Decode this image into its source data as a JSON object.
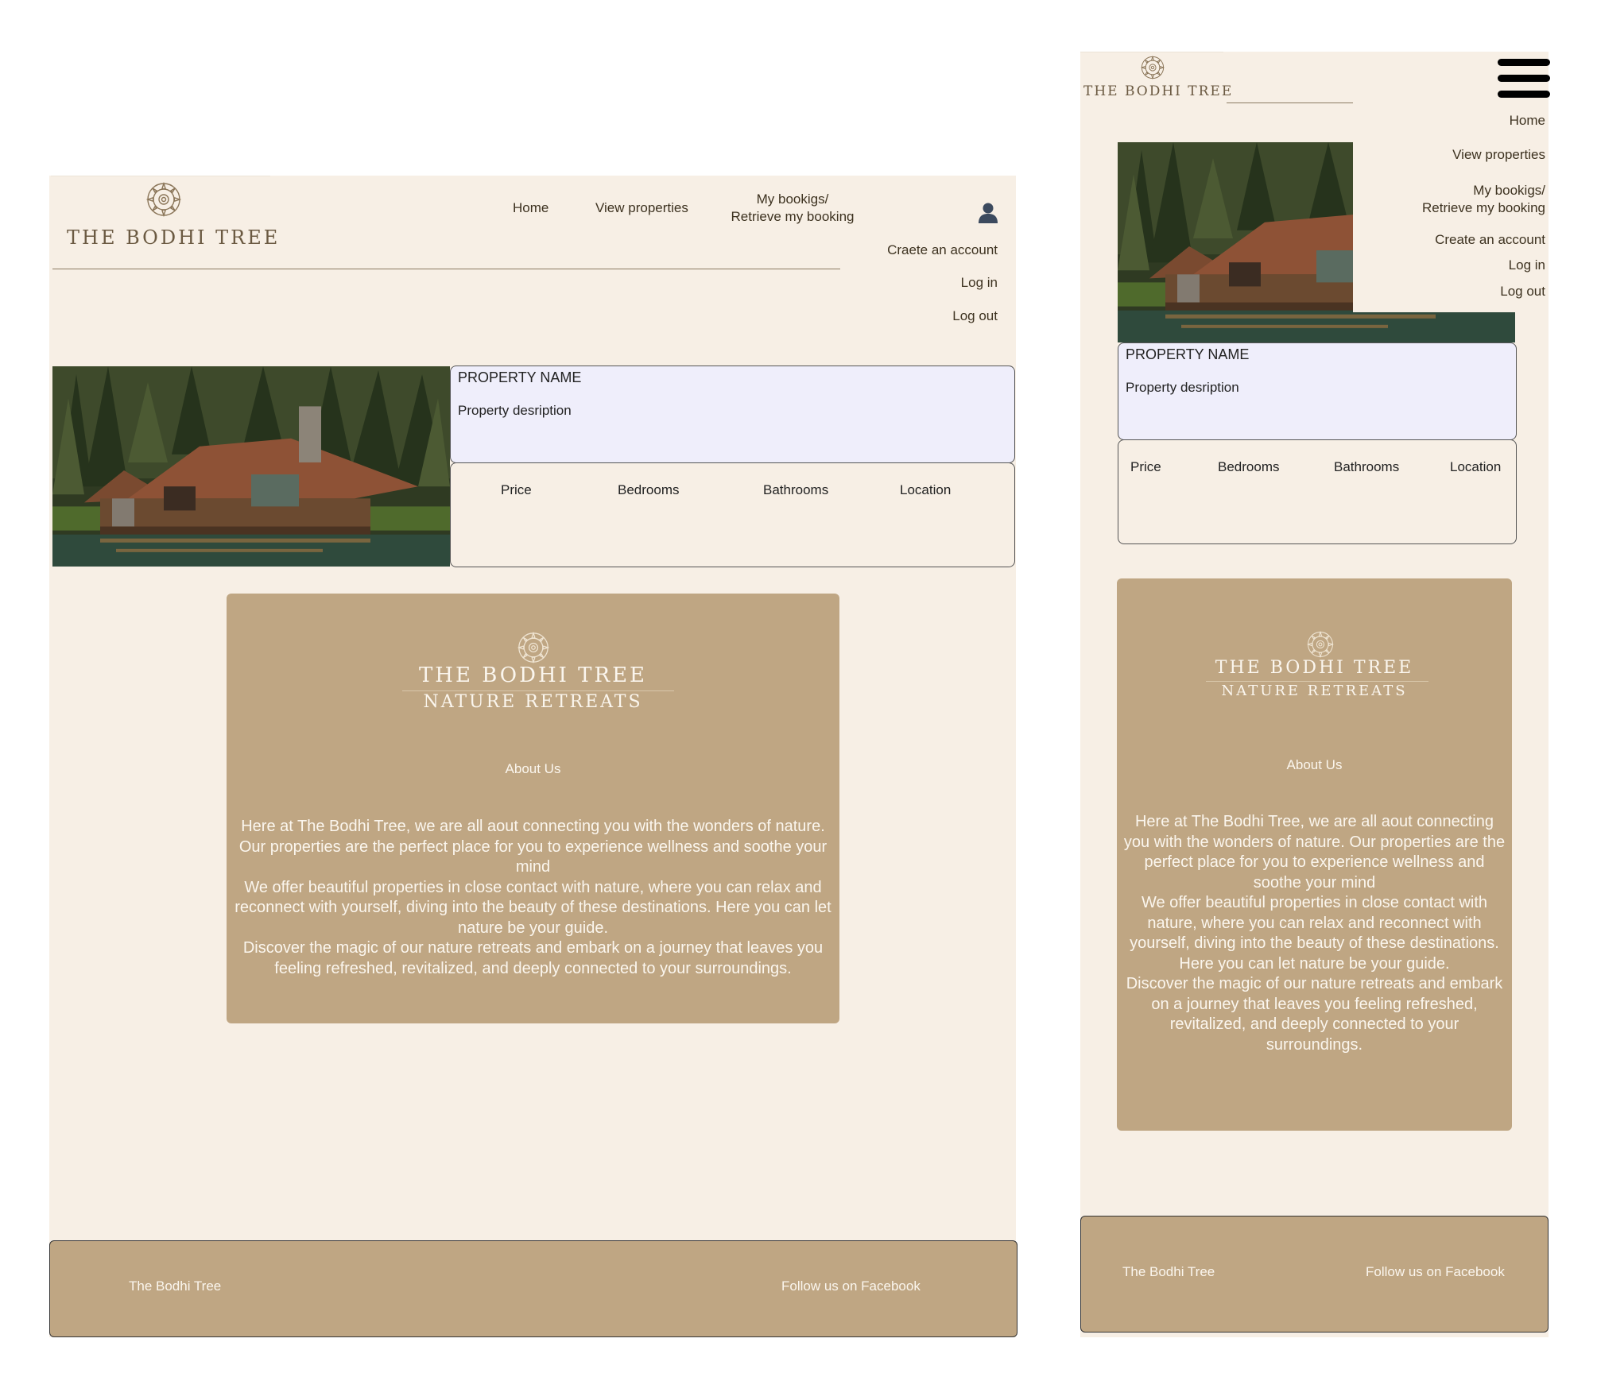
{
  "brand": {
    "name": "THE BODHI TREE",
    "about_brand_line1": "THE BODHI TREE",
    "about_brand_line2": "NATURE RETREATS"
  },
  "nav": {
    "home": "Home",
    "view_properties": "View properties",
    "my_bookings_line1": "My bookigs/",
    "my_bookings_line2": "Retrieve my booking",
    "create_account_desktop": "Craete an account",
    "create_account_mobile": "Create an account",
    "log_in": "Log in",
    "log_out": "Log out"
  },
  "property": {
    "name": "PROPERTY NAME",
    "description": "Property desription",
    "attributes": [
      "Price",
      "Bedrooms",
      "Bathrooms",
      "Location"
    ]
  },
  "about": {
    "title": "About Us",
    "paragraphs": [
      "Here at The Bodhi Tree, we are all aout connecting you with the wonders of nature. Our properties are the perfect place for you to experience wellness and soothe your mind",
      "We offer beautiful properties in close contact with nature, where you can relax and reconnect with yourself, diving into the beauty of these destinations. Here you can let nature be your guide.",
      "Discover the magic of our nature retreats and embark on a journey that leaves you feeling refreshed, revitalized, and deeply connected to your surroundings."
    ]
  },
  "footer": {
    "name": "The Bodhi Tree",
    "social": "Follow us on Facebook"
  },
  "colors": {
    "page_bg": "#f7efe5",
    "accent_tan": "#bfa683",
    "property_box": "#efeefb",
    "brand_text": "#6b5a42"
  },
  "icons": [
    "lotus-logo-icon",
    "user-icon",
    "hamburger-menu-icon"
  ]
}
